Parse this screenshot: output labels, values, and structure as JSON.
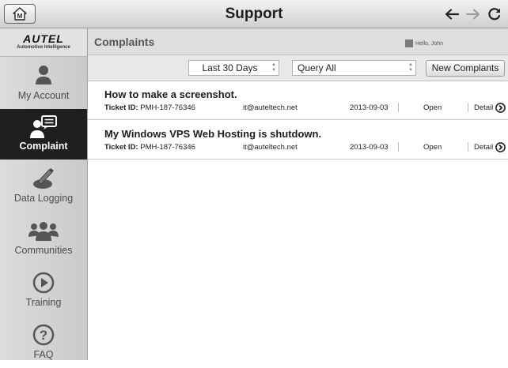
{
  "topbar": {
    "title": "Support"
  },
  "sidebar": {
    "brand": "AUTEL",
    "tagline": "Automotive Intelligence",
    "items": [
      {
        "label": "My Account",
        "icon": "person-icon"
      },
      {
        "label": "Complaint",
        "icon": "complaint-icon",
        "active": true
      },
      {
        "label": "Data Logging",
        "icon": "data-logging-icon"
      },
      {
        "label": "Communities",
        "icon": "communities-icon"
      },
      {
        "label": "Training",
        "icon": "play-icon"
      },
      {
        "label": "FAQ",
        "icon": "question-icon"
      }
    ]
  },
  "main": {
    "title": "Complaints",
    "user": "Hello, John",
    "filters": {
      "period": "Last 30 Days",
      "query": "Query All"
    },
    "new_button": "New Complants",
    "rows": [
      {
        "subject": "How to make a screenshot.",
        "ticket_label": "Ticket ID:",
        "ticket_id": "PMH-187-76346",
        "email": "it@auteltech.net",
        "date": "2013-09-03",
        "status": "Open",
        "detail": "Detail"
      },
      {
        "subject": "My Windows VPS Web Hosting is shutdown.",
        "ticket_label": "Ticket ID:",
        "ticket_id": "PMH-187-76346",
        "email": "it@auteltech.net",
        "date": "2013-09-03",
        "status": "Open",
        "detail": "Detail"
      }
    ]
  }
}
